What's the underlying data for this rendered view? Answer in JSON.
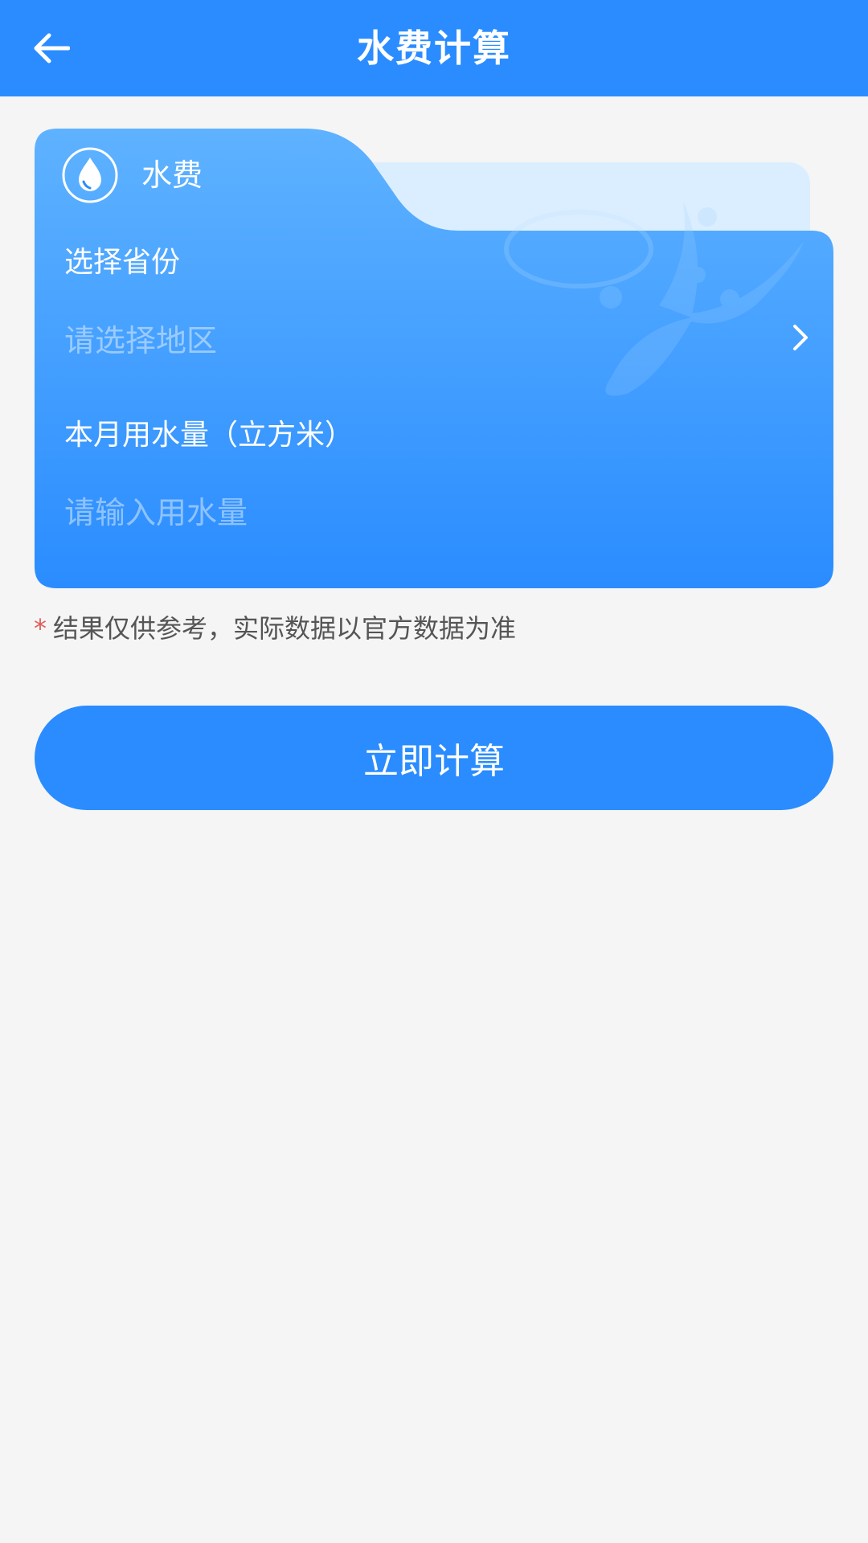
{
  "header": {
    "title": "水费计算",
    "back_icon": "arrow-left-icon"
  },
  "card": {
    "tab_label": "水费",
    "tab_icon": "water-drop-icon",
    "province": {
      "label": "选择省份",
      "placeholder": "请选择地区",
      "chevron_icon": "chevron-right-icon"
    },
    "water_usage": {
      "label": "本月用水量（立方米）",
      "placeholder": "请输入用水量",
      "value": ""
    }
  },
  "note": {
    "star": "*",
    "text": "结果仅供参考，实际数据以官方数据为准"
  },
  "action": {
    "calculate_label": "立即计算"
  },
  "colors": {
    "primary": "#2a8cff",
    "background": "#f5f5f5",
    "note_star": "#e25c5c",
    "note_text": "#555555"
  }
}
